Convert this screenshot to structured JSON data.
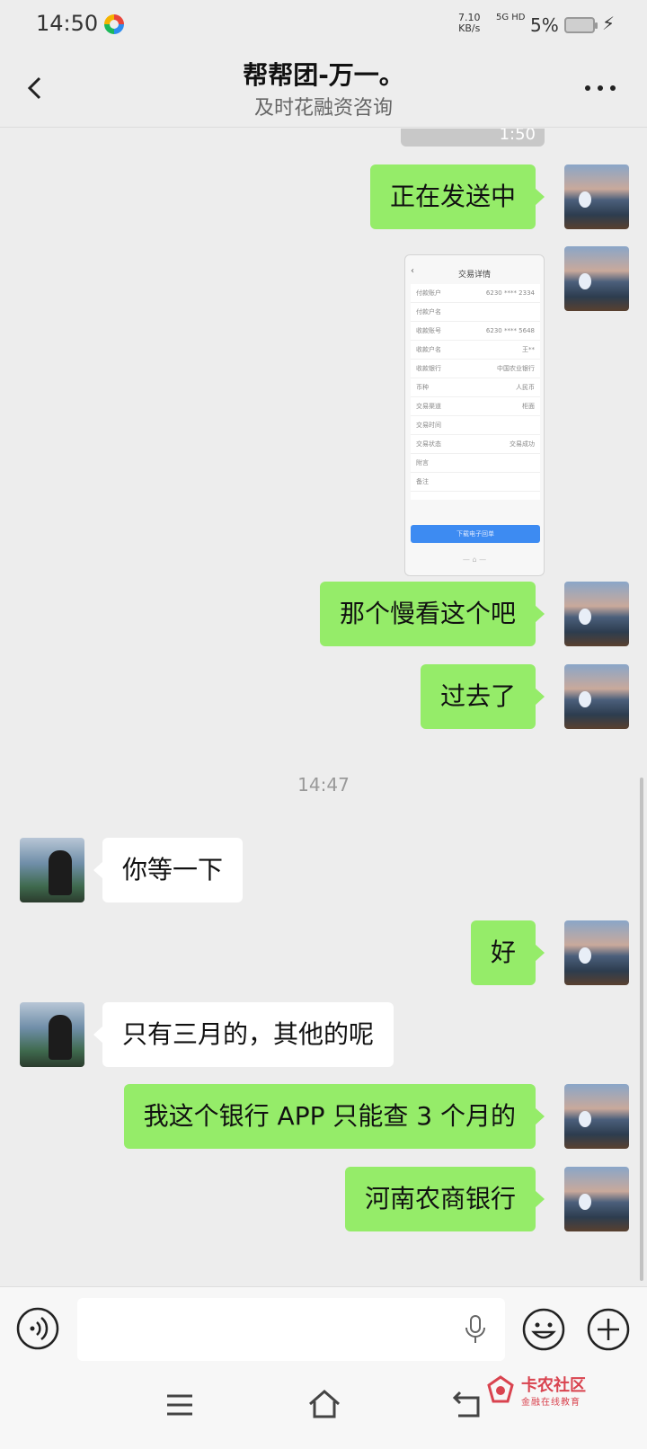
{
  "status_bar": {
    "time": "14:50",
    "net_speed_value": "7.10",
    "net_speed_unit": "KB/s",
    "net_type": "5G HD",
    "battery": "5%"
  },
  "header": {
    "title": "帮帮团-万一。",
    "subtitle": "及时花融资咨询"
  },
  "partial_image": {
    "time_text": "1:50"
  },
  "screenshot_thumb": {
    "title": "交易详情",
    "rows": [
      {
        "left": "付款账户",
        "right": "6230 **** 2334"
      },
      {
        "left": "付款户名",
        "right": ""
      },
      {
        "left": "收款账号",
        "right": "6230 **** 5648"
      },
      {
        "left": "收款户名",
        "right": "王**"
      },
      {
        "left": "收款银行",
        "right": "中国农业银行"
      },
      {
        "left": "币种",
        "right": "人民币"
      },
      {
        "left": "交易渠道",
        "right": "柜面"
      },
      {
        "left": "交易时间",
        "right": ""
      },
      {
        "left": "交易状态",
        "right": "交易成功"
      },
      {
        "left": "附言",
        "right": ""
      },
      {
        "left": "备注",
        "right": ""
      }
    ],
    "button": "下载电子回单"
  },
  "messages": [
    {
      "from": "self",
      "text": "正在发送中"
    },
    {
      "from": "self",
      "text": "那个慢看这个吧"
    },
    {
      "from": "self",
      "text": "过去了"
    },
    {
      "from": "other",
      "text": "你等一下"
    },
    {
      "from": "self",
      "text": "好"
    },
    {
      "from": "other",
      "text": "只有三月的，其他的呢"
    },
    {
      "from": "self",
      "text": "我这个银行 APP 只能查 3 个月的"
    },
    {
      "from": "self",
      "text": "河南农商银行"
    }
  ],
  "time_divider": "14:47",
  "watermark": {
    "name": "卡农社区",
    "sub": "金融在线教育"
  },
  "colors": {
    "self_bubble": "#95ec69",
    "other_bubble": "#ffffff",
    "background": "#ededed",
    "watermark": "#d9434f"
  }
}
